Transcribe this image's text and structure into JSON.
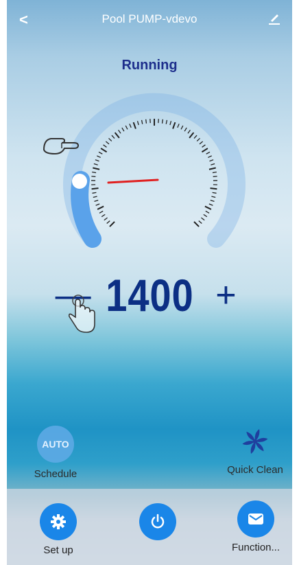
{
  "header": {
    "title": "Pool PUMP-vdevo"
  },
  "status": "Running",
  "speed": {
    "value": "1400",
    "minus": "—",
    "plus": "+"
  },
  "modes": {
    "schedule": "Schedule",
    "auto_badge": "AUTO",
    "quick_clean": "Quick Clean"
  },
  "footer": {
    "setup": "Set up",
    "function": "Function..."
  },
  "colors": {
    "accent": "#1a86e8",
    "status_text": "#1d2e8c",
    "speed_text": "#0c2f84",
    "needle": "#e02020"
  },
  "icons": [
    "back-icon",
    "edit-icon",
    "pointer-hand-icon",
    "tap-hand-icon",
    "fan-icon",
    "gear-icon",
    "power-icon",
    "mail-icon"
  ]
}
